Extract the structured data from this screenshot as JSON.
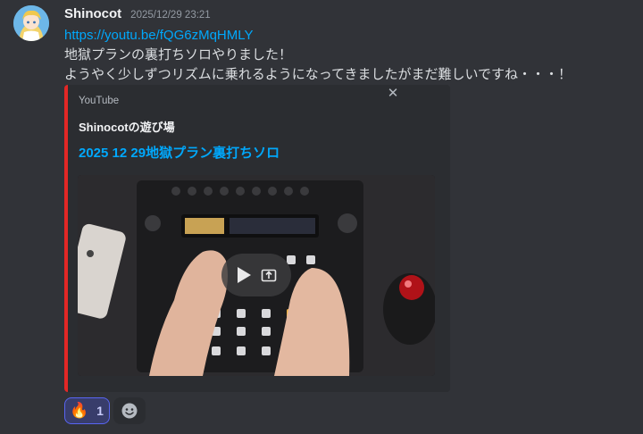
{
  "message": {
    "username": "Shinocot",
    "timestamp": "2025/12/29 23:21",
    "link": "https://youtu.be/fQG6zMqHMLY",
    "lines": [
      "地獄プランの裏打ちソロやりました！",
      "ようやく少しずつリズムに乗れるようになってきましたがまだ難しいですね・・・！"
    ]
  },
  "embed": {
    "provider": "YouTube",
    "author": "Shinocotの遊び場",
    "title": "2025 12 29地獄プラン裏打ちソロ",
    "close_glyph": "✕",
    "accent_color": "#e32726"
  },
  "reactions": [
    {
      "emoji": "🔥",
      "count": "1",
      "active": true
    },
    {
      "icon": "add-reaction-icon"
    }
  ],
  "colors": {
    "background": "#313338",
    "link": "#00a8fc",
    "embed_background": "#2b2d31"
  }
}
